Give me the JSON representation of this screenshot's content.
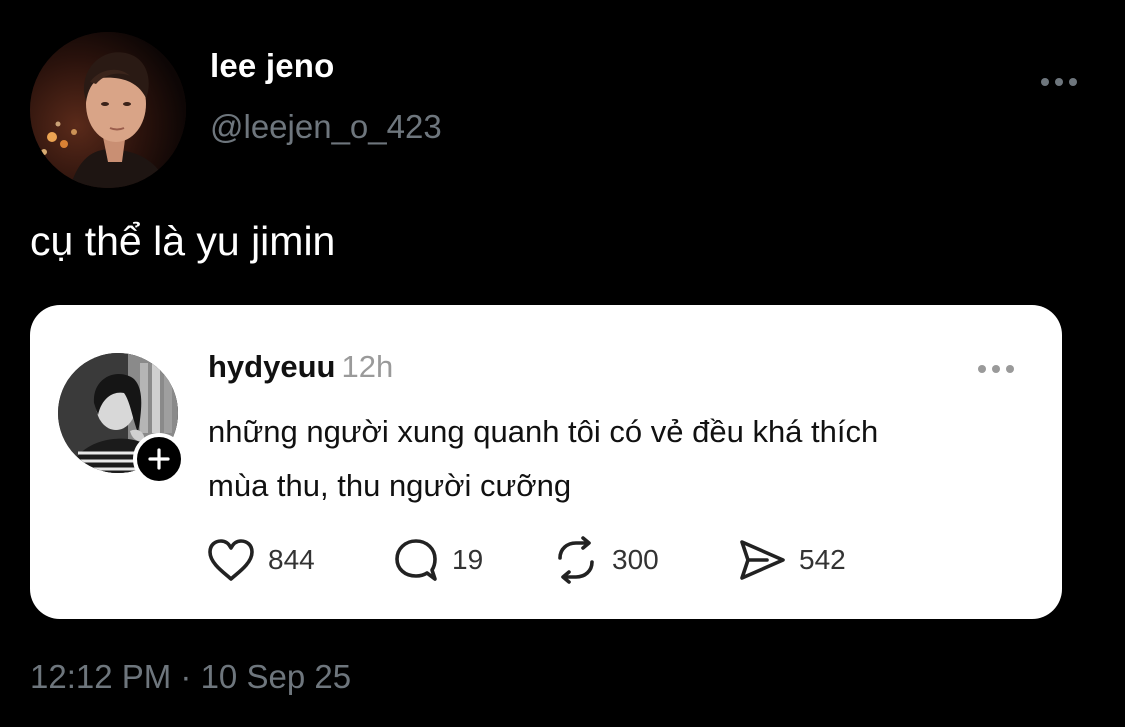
{
  "tweet": {
    "author": {
      "display_name": "lee jeno",
      "handle": "@leejen_o_423",
      "avatar_icon": "profile-photo"
    },
    "more_icon": "more-horizontal-icon",
    "text": "cụ thể là yu jimin",
    "timestamp": "12:12 PM · 10 Sep 25"
  },
  "quote": {
    "username": "hydyeuu",
    "time": "12h",
    "avatar_icon": "profile-photo",
    "follow_icon": "plus-icon",
    "more_icon": "more-horizontal-icon",
    "text_lines": [
      "những người xung quanh tôi có vẻ đều khá thích",
      "mùa thu, thu người cưỡng"
    ],
    "actions": {
      "likes": "844",
      "replies": "19",
      "reposts": "300",
      "shares": "542"
    }
  },
  "colors": {
    "background": "#000000",
    "secondary_text": "#6e767d",
    "card_background": "#ffffff"
  }
}
